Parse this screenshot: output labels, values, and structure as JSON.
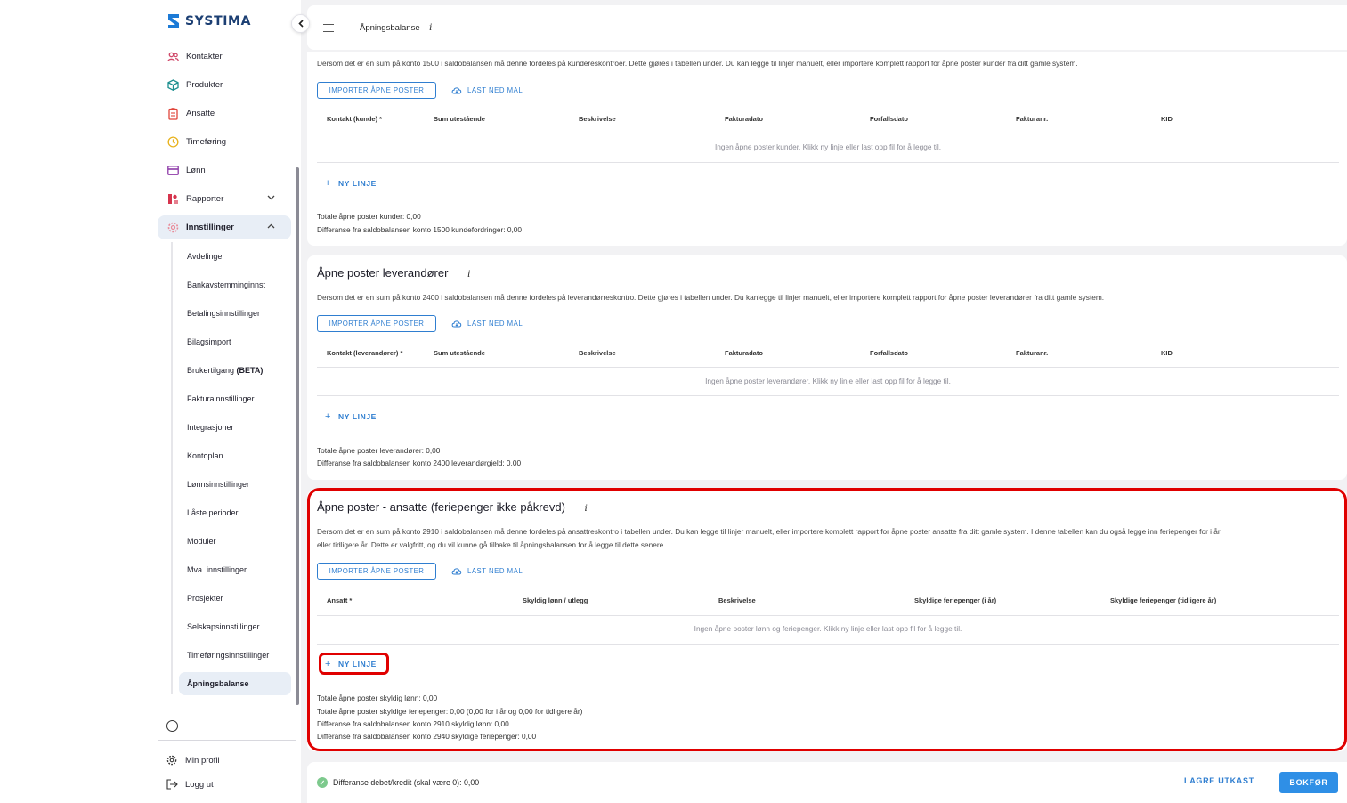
{
  "brand": {
    "name": "SYSTIMA"
  },
  "header": {
    "title": "Åpningsbalanse",
    "info_glyph": "i"
  },
  "sidebar": {
    "items": [
      {
        "label": "Kontakter",
        "icon": "users-icon",
        "color": "#d14a6b"
      },
      {
        "label": "Produkter",
        "icon": "cube-icon",
        "color": "#1a8e8e"
      },
      {
        "label": "Ansatte",
        "icon": "id-badge-icon",
        "color": "#e0453b"
      },
      {
        "label": "Timeføring",
        "icon": "clock-icon",
        "color": "#e8b21c"
      },
      {
        "label": "Lønn",
        "icon": "card-icon",
        "color": "#8e3aa8"
      },
      {
        "label": "Rapporter",
        "icon": "chart-icon",
        "color": "#d6344d"
      },
      {
        "label": "Innstillinger",
        "icon": "gear-icon",
        "color": "#e98a98"
      }
    ],
    "sub_items": [
      "Avdelinger",
      "Bankavstemminginnst",
      "Betalingsinnstillinger",
      "Bilagsimport",
      "Brukertilgang",
      "Fakturainnstillinger",
      "Integrasjoner",
      "Kontoplan",
      "Lønnsinnstillinger",
      "Låste perioder",
      "Moduler",
      "Mva. innstillinger",
      "Prosjekter",
      "Selskapsinnstillinger",
      "Timeføringsinnstillinger",
      "Åpningsbalanse"
    ],
    "beta_tag": "(BETA)",
    "footer": {
      "profile": "Min profil",
      "logout": "Logg ut"
    }
  },
  "common": {
    "import_btn": "IMPORTER ÅPNE POSTER",
    "download_btn": "LAST NED MAL",
    "new_line_btn": "NY LINJE",
    "plus": "+"
  },
  "kunder": {
    "desc": "Dersom det er en sum på konto 1500 i saldobalansen må denne fordeles på kundereskontroer. Dette gjøres i tabellen under. Du kan legge til linjer manuelt, eller importere komplett rapport for åpne poster kunder fra ditt gamle system.",
    "columns": [
      "Kontakt (kunde) *",
      "Sum utestående",
      "Beskrivelse",
      "Fakturadato",
      "Forfallsdato",
      "Fakturanr.",
      "KID"
    ],
    "empty": "Ingen åpne poster kunder. Klikk ny linje eller last opp fil for å legge til.",
    "total": "Totale åpne poster kunder: 0,00",
    "diff": "Differanse fra saldobalansen konto 1500 kundefordringer: 0,00"
  },
  "leverandorer": {
    "title": "Åpne poster leverandører",
    "desc": "Dersom det er en sum på konto 2400 i saldobalansen må denne fordeles på leverandørreskontro. Dette gjøres i tabellen under. Du kanlegge til linjer manuelt, eller importere komplett rapport for åpne poster leverandører fra ditt gamle system.",
    "columns": [
      "Kontakt (leverandører) *",
      "Sum utestående",
      "Beskrivelse",
      "Fakturadato",
      "Forfallsdato",
      "Fakturanr.",
      "KID"
    ],
    "empty": "Ingen åpne poster leverandører. Klikk ny linje eller last opp fil for å legge til.",
    "total": "Totale åpne poster leverandører: 0,00",
    "diff": "Differanse fra saldobalansen konto 2400 leverandørgjeld: 0,00"
  },
  "ansatte": {
    "title": "Åpne poster - ansatte (feriepenger ikke påkrevd)",
    "desc_line1": "Dersom det er en sum på konto 2910 i saldobalansen må denne fordeles på ansattreskontro i tabellen under. Du kan legge til linjer manuelt, eller importere komplett rapport for åpne poster ansatte fra ditt gamle system. I denne tabellen kan du også legge inn feriepenger for i år",
    "desc_line2": "eller tidligere år. Dette er valgfritt, og du vil kunne gå tilbake til åpningsbalansen for å legge til dette senere.",
    "columns": [
      "Ansatt *",
      "Skyldig lønn / utlegg",
      "Beskrivelse",
      "Skyldige feriepenger (i år)",
      "Skyldige feriepenger (tidligere år)"
    ],
    "empty": "Ingen åpne poster lønn og feriepenger. Klikk ny linje eller last opp fil for å legge til.",
    "sums": [
      "Totale åpne poster skyldig lønn: 0,00",
      "Totale åpne poster skyldige feriepenger: 0,00 (0,00 for i år og 0,00 for tidligere år)",
      "Differanse fra saldobalansen konto 2910 skyldig lønn: 0,00",
      "Differanse fra saldobalansen konto 2940 skyldige feriepenger: 0,00"
    ]
  },
  "footer": {
    "status": "Differanse debet/kredit (skal være 0): 0,00",
    "check": "✓",
    "save_draft": "LAGRE UTKAST",
    "post": "BOKFØR"
  },
  "colors": {
    "accent": "#2f7ed0",
    "highlight": "#e00000",
    "primary_btn": "#2f8fe6"
  }
}
